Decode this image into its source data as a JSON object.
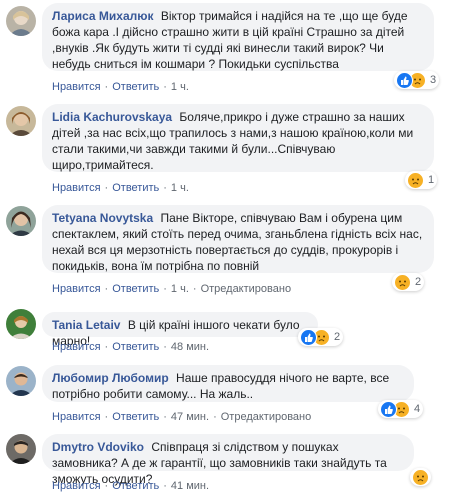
{
  "comments": [
    {
      "name": "Лариса Михалюк",
      "text": "Віктор тримайся і надійся на те ,що ще буде божа кара .І дійсно страшно жити в цій країні Страшно за дітей ,внуків .Як будуть жити ті судді які винесли такий вирок? Чи небудь сниться ім кошмари ? Покидьки суспільства",
      "like_label": "Нравится",
      "reply_label": "Ответить",
      "time": "1 ч.",
      "reaction_count": "3"
    },
    {
      "name": "Lidia Kachurovskaya",
      "text": "Боляче,прикро і дуже страшно за наших дітей ,за нас всіх,що трапилось з нами,з нашою країною,коли ми стали такими,чи завжди такими й були...Співчуваю щиро,тримайтеся.",
      "like_label": "Нравится",
      "reply_label": "Ответить",
      "time": "1 ч.",
      "reaction_count": "1"
    },
    {
      "name": "Tetyana Novytska",
      "text": "Пане Вікторе, співчуваю Вам і обурена цим спектаклем, який стоїть перед очима, зганьблена гідність всіх нас, нехай вся ця мерзотність повертається до суддів, прокурорів і покидьків, вона їм потрібна по повній",
      "like_label": "Нравится",
      "reply_label": "Ответить",
      "time": "1 ч.",
      "edited_label": "Отредактировано",
      "reaction_count": "2"
    },
    {
      "name": "Tania Letaiv",
      "text": "В цій країні іншого чекати було марно!",
      "like_label": "Нравится",
      "reply_label": "Ответить",
      "time": "48 мин.",
      "reaction_count": "2"
    },
    {
      "name": "Любомир Любомир",
      "text": "Наше правосуддя нічого не варте, все потрібно робити самому... На жаль..",
      "like_label": "Нравится",
      "reply_label": "Ответить",
      "time": "47 мин.",
      "edited_label": "Отредактировано",
      "reaction_count": "4"
    },
    {
      "name": "Dmytro Vdoviko",
      "text": "Співпраця зі слідством у пошуках замовника? А де ж гарантії, що замовників таки знайдуть та зможуть осудити?",
      "like_label": "Нравится",
      "reply_label": "Ответить",
      "time": "41 мин.",
      "reaction_count": ""
    }
  ],
  "colors": {
    "name": "#385898",
    "bubble": "#f2f3f5",
    "meta": "#606770",
    "like": "#1877f2",
    "sad": "#f7b125"
  }
}
